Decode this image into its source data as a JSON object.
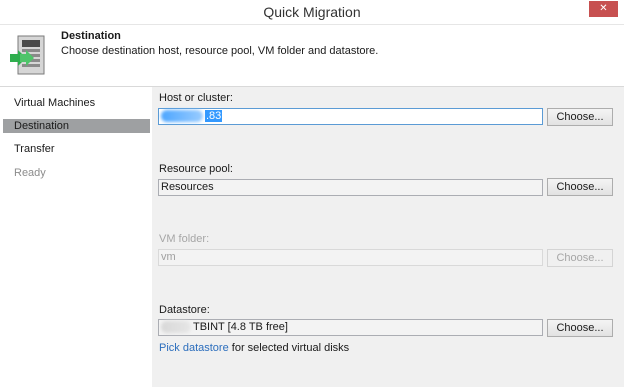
{
  "window": {
    "title": "Quick Migration",
    "close_glyph": "✕"
  },
  "header": {
    "title": "Destination",
    "description": "Choose destination host, resource pool, VM folder and datastore.",
    "icon": "migration-wizard-icon"
  },
  "sidebar": {
    "steps": [
      {
        "label": "Virtual Machines",
        "state": "normal"
      },
      {
        "label": "Destination",
        "state": "active"
      },
      {
        "label": "Transfer",
        "state": "normal"
      },
      {
        "label": "Ready",
        "state": "disabled"
      }
    ]
  },
  "form": {
    "host": {
      "label": "Host or cluster:",
      "value_visible": ".83",
      "button": "Choose..."
    },
    "resource_pool": {
      "label": "Resource pool:",
      "value": "Resources",
      "button": "Choose..."
    },
    "vm_folder": {
      "label": "VM folder:",
      "value": "vm",
      "button": "Choose..."
    },
    "datastore": {
      "label": "Datastore:",
      "value_visible": "TBINT [4.8 TB free]",
      "button": "Choose..."
    },
    "pick_datastore": {
      "link": "Pick datastore",
      "text": "for selected virtual disks"
    }
  },
  "colors": {
    "active_step_bg": "#9ea0a2",
    "link": "#2c6ebd",
    "selection": "#3399ff",
    "close_button": "#c75050"
  }
}
